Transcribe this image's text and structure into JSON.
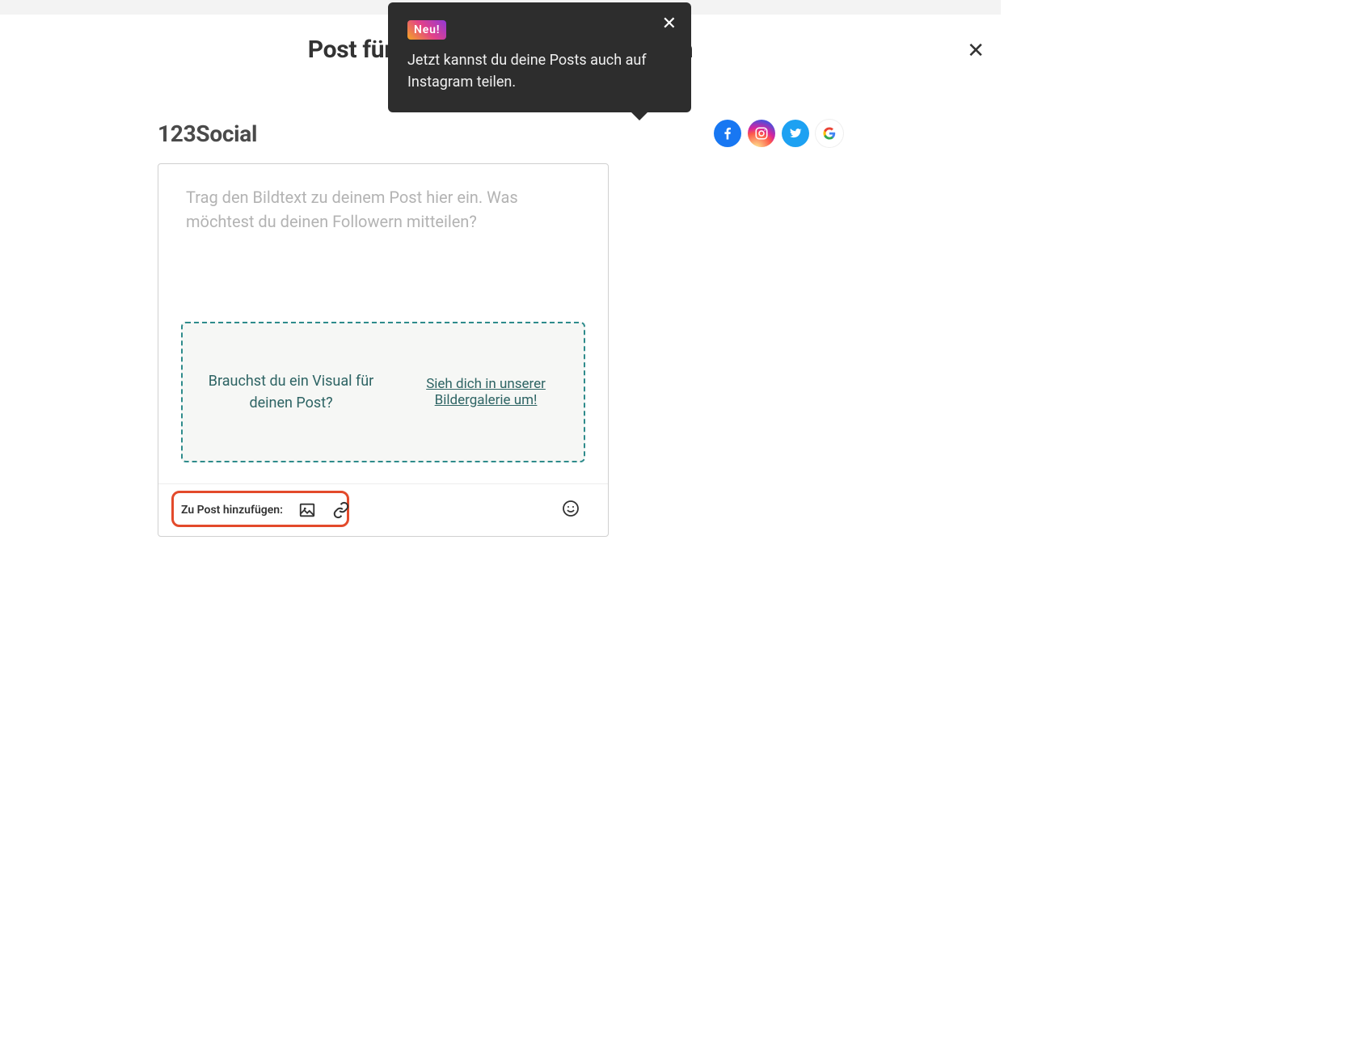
{
  "page": {
    "title": "Post für soziale Netzwerke erstellen"
  },
  "tooltip": {
    "badge": "Neu!",
    "body": "Jetzt kannst du deine Posts auch auf Instagram teilen."
  },
  "account": {
    "name": "123Social"
  },
  "social_icons": [
    "facebook",
    "instagram",
    "twitter",
    "google"
  ],
  "composer": {
    "placeholder": "Trag den Bildtext zu deinem Post hier ein. Was möchtest du deinen Followern mitteilen?",
    "visual_prompt": "Brauchst du ein Visual für deinen Post?",
    "visual_link": "Sieh dich in unserer Bildergalerie um!",
    "add_label": "Zu Post hinzufügen:"
  }
}
